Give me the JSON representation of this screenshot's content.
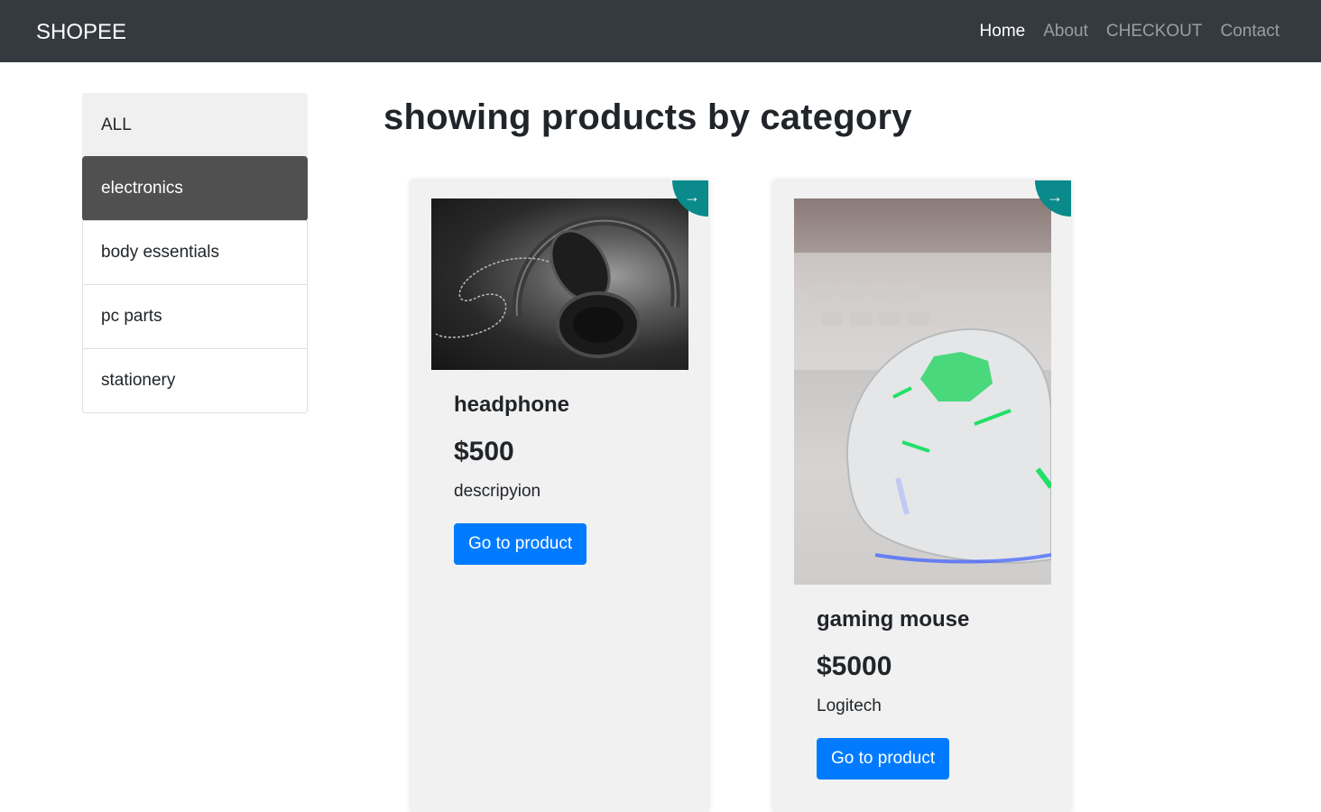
{
  "navbar": {
    "brand": "SHOPEE",
    "links": [
      {
        "label": "Home",
        "active": true
      },
      {
        "label": "About",
        "active": false
      },
      {
        "label": "CHECKOUT",
        "active": false
      },
      {
        "label": "Contact",
        "active": false
      }
    ]
  },
  "sidebar": {
    "items": [
      {
        "label": "ALL"
      },
      {
        "label": "electronics",
        "selected": true
      },
      {
        "label": "body essentials"
      },
      {
        "label": "pc parts"
      },
      {
        "label": "stationery"
      }
    ]
  },
  "main": {
    "title": "showing products by category",
    "products": [
      {
        "name": "headphone",
        "price": "$500",
        "description": "descripyion",
        "button": "Go to product",
        "corner_icon": "→",
        "image": "headphone-photo"
      },
      {
        "name": "gaming mouse",
        "price": "$5000",
        "description": "Logitech",
        "button": "Go to product",
        "corner_icon": "→",
        "image": "gaming-mouse-photo"
      }
    ]
  },
  "colors": {
    "navbar_bg": "#343a40",
    "selected_category_bg": "#505050",
    "button_primary": "#007bff",
    "corner_badge": "#0a8a8a"
  }
}
